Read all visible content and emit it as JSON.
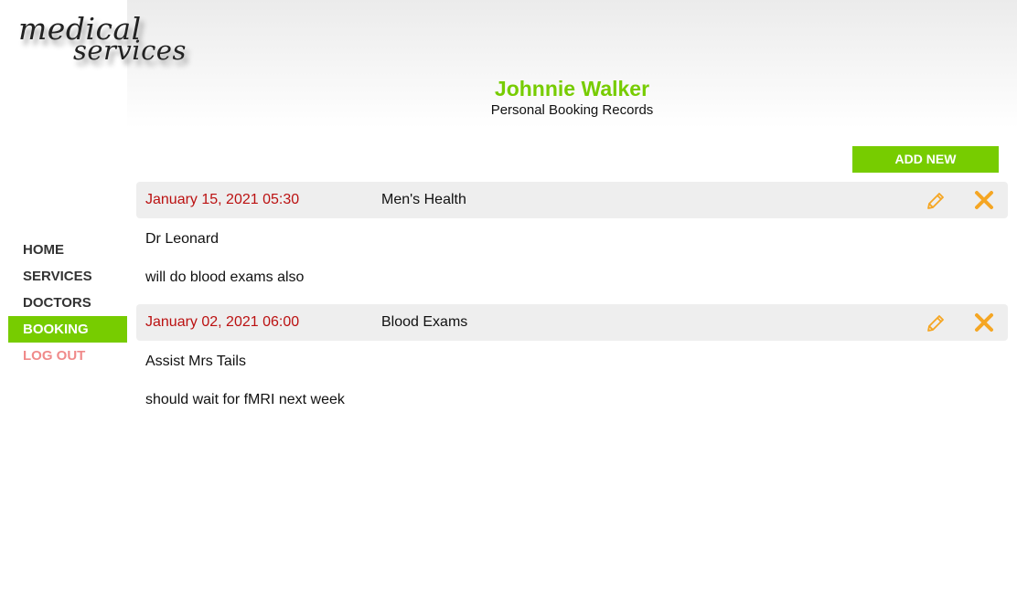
{
  "logo": {
    "line1": "medical",
    "line2": "services"
  },
  "header": {
    "user_name": "Johnnie Walker",
    "subtitle": "Personal Booking Records"
  },
  "nav": {
    "items": [
      {
        "label": "HOME"
      },
      {
        "label": "SERVICES"
      },
      {
        "label": "DOCTORS"
      },
      {
        "label": "BOOKING",
        "active": true
      },
      {
        "label": "LOG OUT"
      }
    ]
  },
  "actions": {
    "add_new_label": "ADD NEW"
  },
  "records": [
    {
      "datetime": "January 15, 2021 05:30",
      "service": "Men's Health",
      "doctor": "Dr Leonard",
      "note": "will do blood exams also"
    },
    {
      "datetime": "January 02, 2021 06:00",
      "service": "Blood Exams",
      "doctor": "Assist Mrs Tails",
      "note": "should wait for fMRI next week"
    }
  ],
  "colors": {
    "accent": "#77cc00",
    "date": "#bb1111",
    "logout": "#f08a8a",
    "icon": "#f5a623"
  }
}
